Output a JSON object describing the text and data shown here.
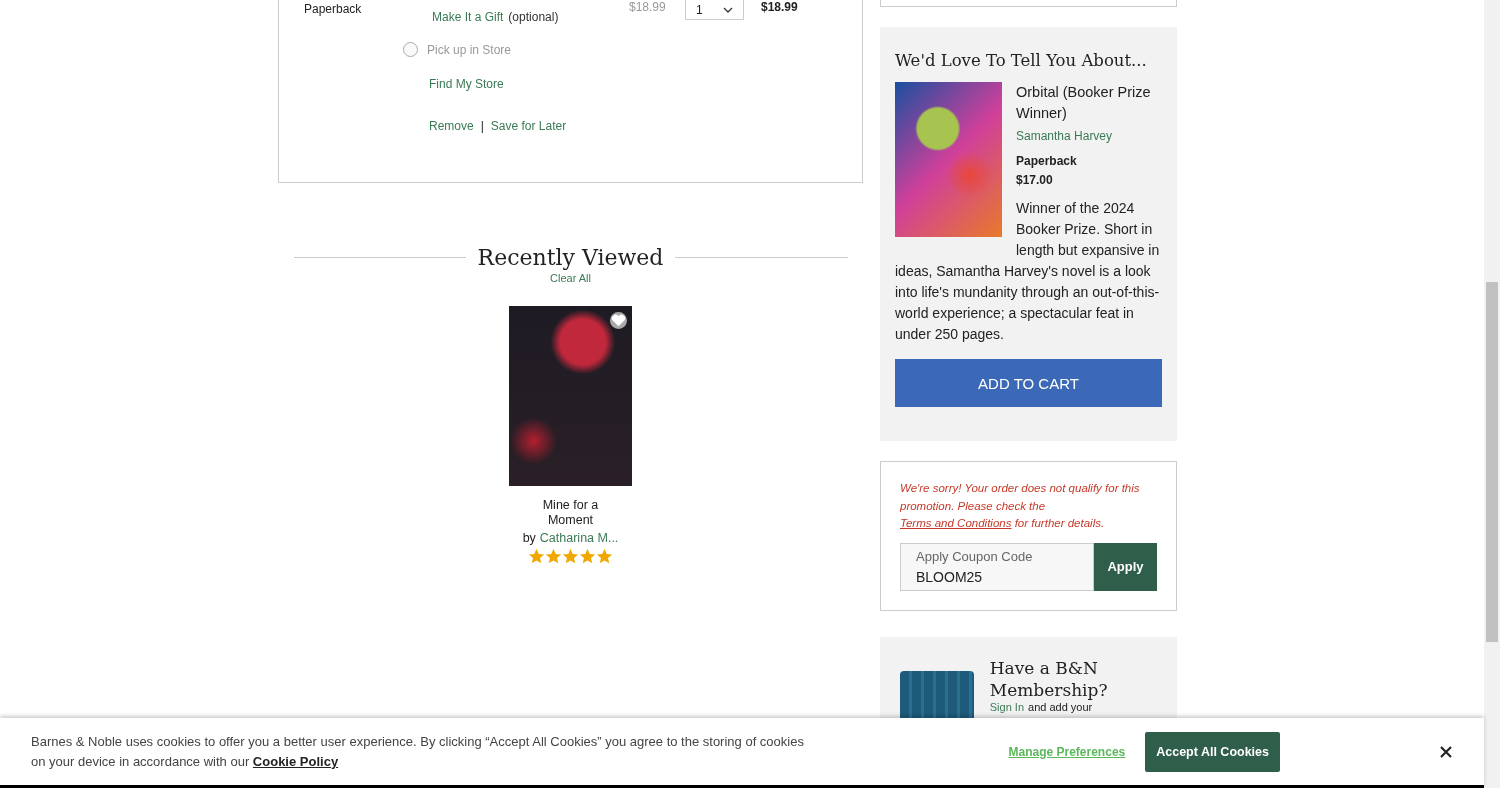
{
  "cart_item": {
    "format": "Paperback",
    "gift_link": "Make It a Gift",
    "gift_note": "(optional)",
    "price": "$18.99",
    "quantity": "1",
    "total": "$18.99",
    "pickup": {
      "label": "Pick up in Store",
      "selected": false,
      "disabled": true
    },
    "find_store": "Find My Store",
    "remove": "Remove",
    "separator": "|",
    "save_for_later": "Save for Later"
  },
  "recently_viewed": {
    "title": "Recently Viewed",
    "clear_all": "Clear All",
    "items": [
      {
        "title": "Mine for a Moment",
        "by": "by",
        "author": "Catharina M...",
        "stars": 5,
        "favorite": false
      }
    ]
  },
  "promo": {
    "heading": "We'd Love To Tell You About...",
    "title": "Orbital (Booker Prize Winner)",
    "author": "Samantha Harvey",
    "format": "Paperback",
    "price": "$17.00",
    "description": "Winner of the 2024 Booker Prize. Short in length but expansive in ideas, Samantha Harvey's novel is a look into life's mundanity through an out-of-this-world experience; a spectacular feat in under 250 pages.",
    "button": "ADD TO CART"
  },
  "coupon": {
    "error": "We're sorry! Your order does not qualify for this promotion. Please check the ",
    "error_link": "Terms and Conditions",
    "error_end": " for further details.",
    "label": "Apply Coupon Code",
    "value": "BLOOM25",
    "button": "Apply"
  },
  "membership": {
    "heading": "Have a B&N Membership?",
    "sign_in": "Sign In",
    "text": "and add your"
  },
  "cookie_banner": {
    "text": "Barnes & Noble uses cookies to offer you a better user experience. By clicking “Accept All Cookies” you agree to the storing of cookies on your device in accordance with our ",
    "link": "Cookie Policy",
    "manage": "Manage Preferences",
    "accept": "Accept All Cookies"
  }
}
